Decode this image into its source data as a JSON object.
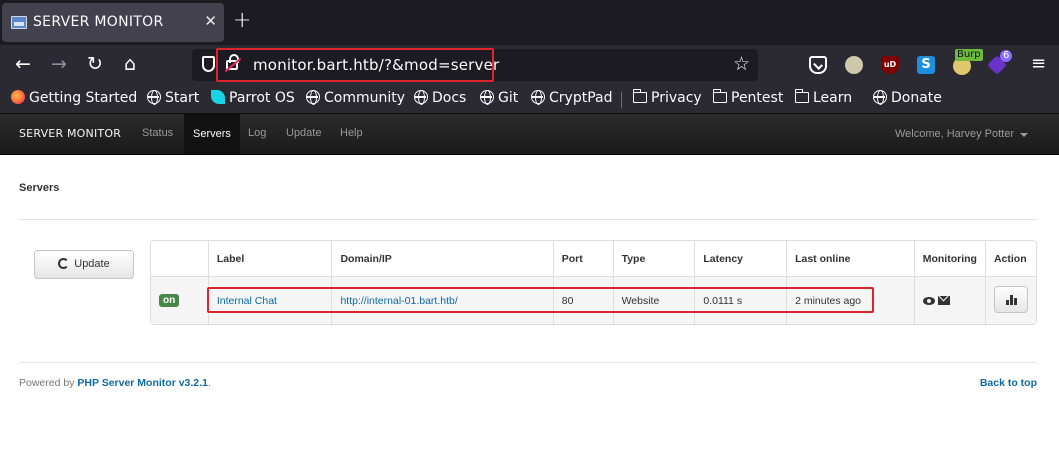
{
  "browser": {
    "tab_title": "SERVER MONITOR",
    "tab_close": "✕",
    "new_tab": "+",
    "url": "monitor.bart.htb/?&mod=server",
    "star": "☆",
    "extensions": {
      "ublock_label": "uD",
      "s_label": "S",
      "burp_badge": "Burp",
      "ext_count": "6",
      "menu": "≡"
    },
    "bookmarks": [
      {
        "label": "Getting Started",
        "icon": "firefox-icon"
      },
      {
        "label": "Start",
        "icon": "globe-icon"
      },
      {
        "label": "Parrot OS",
        "icon": "parrot-icon"
      },
      {
        "label": "Community",
        "icon": "globe-icon"
      },
      {
        "label": "Docs",
        "icon": "globe-icon"
      },
      {
        "label": "Git",
        "icon": "globe-icon"
      },
      {
        "label": "CryptPad",
        "icon": "globe-icon"
      },
      {
        "label": "Privacy",
        "icon": "folder-icon"
      },
      {
        "label": "Pentest",
        "icon": "folder-icon"
      },
      {
        "label": "Learn",
        "icon": "folder-icon"
      },
      {
        "label": "Donate",
        "icon": "globe-icon"
      }
    ]
  },
  "app": {
    "brand": "SERVER MONITOR",
    "nav": [
      "Status",
      "Servers",
      "Log",
      "Update",
      "Help"
    ],
    "active_nav": "Servers",
    "welcome": "Welcome, Harvey Potter"
  },
  "page": {
    "heading": "Servers",
    "update_button": "Update",
    "table": {
      "headers": [
        "",
        "Label",
        "Domain/IP",
        "Port",
        "Type",
        "Latency",
        "Last online",
        "Monitoring",
        "Action"
      ],
      "rows": [
        {
          "status": "on",
          "label": "Internal Chat",
          "domain": "http://internal-01.bart.htb/",
          "port": "80",
          "type": "Website",
          "latency": "0.0111 s",
          "last_online": "2 minutes ago"
        }
      ]
    },
    "footer": {
      "powered_prefix": "Powered by ",
      "powered_link": "PHP Server Monitor v3.2.1",
      "powered_suffix": ".",
      "back_to_top": "Back to top"
    }
  },
  "colors": {
    "highlight": "#e0242e",
    "link": "#0c6aa4",
    "status_on": "#468847"
  }
}
